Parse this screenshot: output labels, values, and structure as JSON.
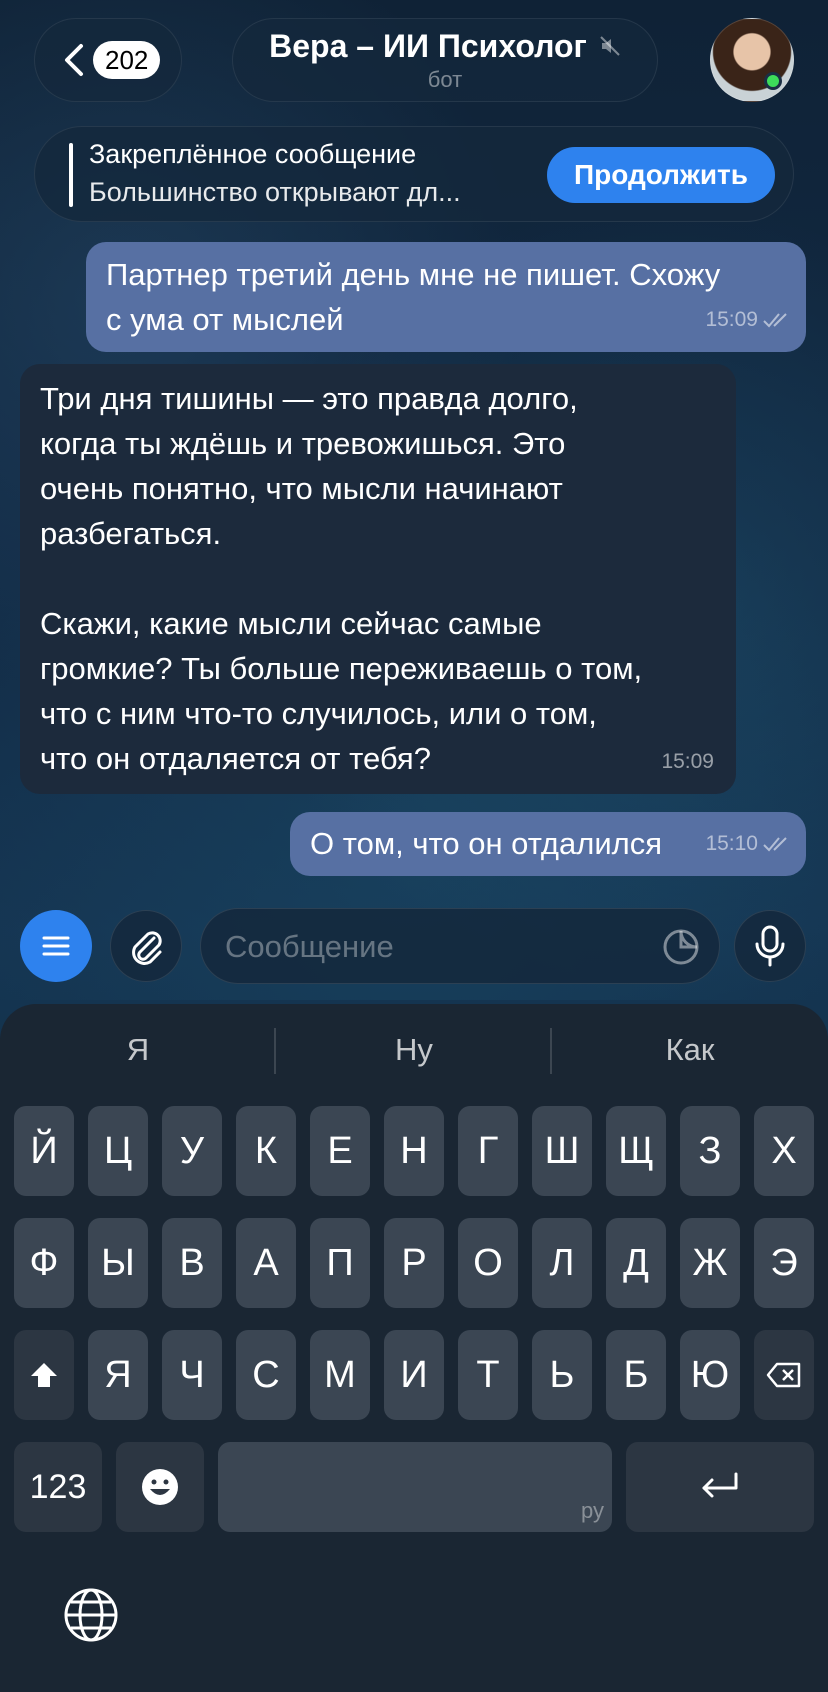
{
  "header": {
    "back_count": "202",
    "title": "Вера – ИИ Психолог",
    "subtitle": "бот"
  },
  "pinned": {
    "title": "Закреплённое сообщение",
    "text": "Большинство открывают дл...",
    "button": "Продолжить"
  },
  "messages": [
    {
      "direction": "out",
      "text": "Партнер третий день мне не пишет. Схожу\nс ума от мыслей",
      "time": "15:09",
      "read": true
    },
    {
      "direction": "in",
      "text": "Три дня тишины — это правда долго,\nкогда ты ждёшь и тревожишься. Это\nочень понятно, что мысли начинают\nразбегаться.\n\nСкажи, какие мысли сейчас самые\nгромкие? Ты больше переживаешь о том,\nчто с ним что-то случилось, или о том,\nчто он отдаляется от тебя?",
      "time": "15:09"
    },
    {
      "direction": "out",
      "text": "О том, что он отдалился",
      "time": "15:10",
      "read": true
    }
  ],
  "composer": {
    "placeholder": "Сообщение"
  },
  "keyboard": {
    "suggestions": [
      "Я",
      "Ну",
      "Как"
    ],
    "row1": [
      "Й",
      "Ц",
      "У",
      "К",
      "Е",
      "Н",
      "Г",
      "Ш",
      "Щ",
      "З",
      "Х"
    ],
    "row2": [
      "Ф",
      "Ы",
      "В",
      "А",
      "П",
      "Р",
      "О",
      "Л",
      "Д",
      "Ж",
      "Э"
    ],
    "row3": [
      "Я",
      "Ч",
      "С",
      "М",
      "И",
      "Т",
      "Ь",
      "Б",
      "Ю"
    ],
    "numbers_label": "123",
    "space_lang": "ру"
  },
  "colors": {
    "accent": "#2e82ee",
    "outgoing_bubble": "#5770a3",
    "incoming_bubble": "#1c2a3c",
    "online": "#3ddc5a"
  }
}
